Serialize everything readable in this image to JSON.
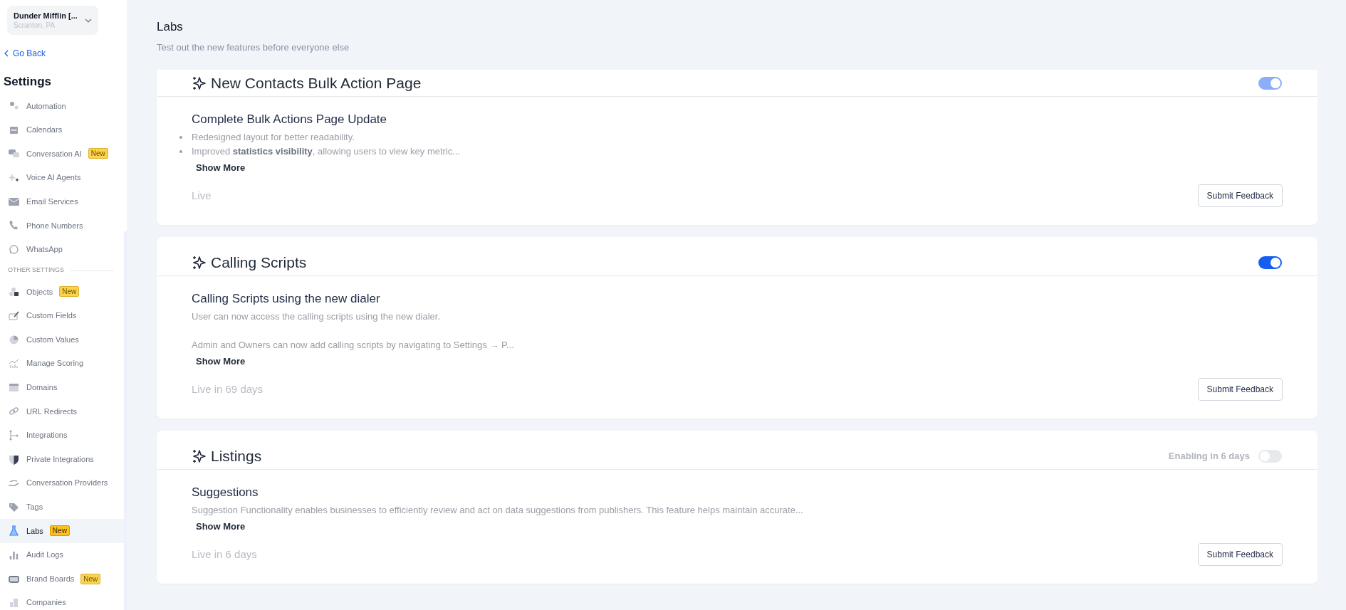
{
  "account": {
    "name": "Dunder Mifflin [...",
    "location": "Scranton, PA"
  },
  "go_back": "Go Back",
  "sidebar": {
    "title": "Settings",
    "items": [
      {
        "kind": "item",
        "label": "Automation",
        "selected": false
      },
      {
        "kind": "item",
        "label": "Calendars",
        "selected": false
      },
      {
        "kind": "item",
        "label": "Conversation AI",
        "badge": "New",
        "selected": false
      },
      {
        "kind": "item",
        "label": "Voice AI Agents",
        "selected": false
      },
      {
        "kind": "item",
        "label": "Email Services",
        "selected": false
      },
      {
        "kind": "item",
        "label": "Phone Numbers",
        "selected": false
      },
      {
        "kind": "item",
        "label": "WhatsApp",
        "selected": false
      },
      {
        "kind": "section",
        "label": "OTHER SETTINGS"
      },
      {
        "kind": "item",
        "label": "Objects",
        "badge": "New",
        "selected": false
      },
      {
        "kind": "item",
        "label": "Custom Fields",
        "selected": false
      },
      {
        "kind": "item",
        "label": "Custom Values",
        "selected": false
      },
      {
        "kind": "item",
        "label": "Manage Scoring",
        "selected": false
      },
      {
        "kind": "item",
        "label": "Domains",
        "selected": false
      },
      {
        "kind": "item",
        "label": "URL Redirects",
        "selected": false
      },
      {
        "kind": "item",
        "label": "Integrations",
        "selected": false
      },
      {
        "kind": "item",
        "label": "Private Integrations",
        "selected": false
      },
      {
        "kind": "item",
        "label": "Conversation Providers",
        "selected": false
      },
      {
        "kind": "item",
        "label": "Tags",
        "selected": false
      },
      {
        "kind": "item",
        "label": "Labs",
        "badge": "New",
        "selected": true
      },
      {
        "kind": "item",
        "label": "Audit Logs",
        "selected": false
      },
      {
        "kind": "item",
        "label": "Brand Boards",
        "badge": "New",
        "selected": false
      },
      {
        "kind": "item",
        "label": "Companies",
        "selected": false
      }
    ]
  },
  "page": {
    "title": "Labs",
    "subtitle": "Test out the new features before everyone else"
  },
  "features": [
    {
      "title": "New Contacts Bulk Action Page",
      "on": true,
      "disabled": true,
      "subtitle": "Complete Bulk Actions Page Update",
      "description": [
        {
          "kind": "bullet",
          "text": "Redesigned layout for better readability."
        },
        {
          "kind": "bullet",
          "text": "Improved **statistics visibility**, allowing users to view key metric..."
        }
      ],
      "show_more": "Show More",
      "status": "Live",
      "button": "Submit Feedback"
    },
    {
      "title": "Calling Scripts",
      "on": true,
      "disabled": false,
      "subtitle": "Calling Scripts using the new dialer",
      "description": [
        {
          "kind": "paragraph",
          "text": "User can now access the calling scripts using the new dialer."
        },
        {
          "kind": "paragraph",
          "text": "Admin and Owners can now add calling scripts by navigating to Settings → P..."
        }
      ],
      "show_more": "Show More",
      "status": "Live in 69 days",
      "button": "Submit Feedback"
    },
    {
      "title": "Listings",
      "on": false,
      "disabled": true,
      "toggle_note": "Enabling in 6 days",
      "subtitle": "Suggestions",
      "description": [
        {
          "kind": "paragraph",
          "text": "Suggestion Functionality enables businesses to efficiently review and act on data suggestions from publishers. This feature helps maintain accurate..."
        }
      ],
      "show_more": "Show More",
      "status": "Live in 6 days",
      "button": "Submit Feedback"
    }
  ]
}
